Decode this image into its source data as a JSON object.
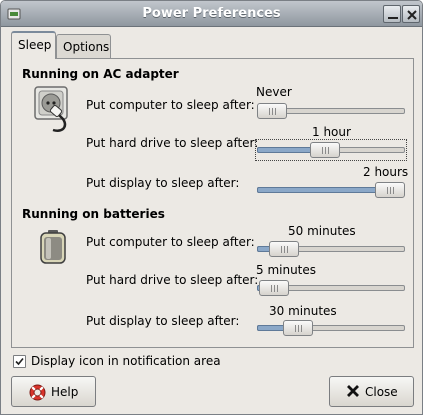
{
  "window": {
    "title": "Power Preferences"
  },
  "tabs": [
    {
      "label": "Sleep",
      "selected": true
    },
    {
      "label": "Options",
      "selected": false
    }
  ],
  "ac": {
    "heading": "Running on AC adapter",
    "rows": [
      {
        "label": "Put computer to sleep after:",
        "value": "Never",
        "fraction": 0.0
      },
      {
        "label": "Put hard drive to sleep after:",
        "value": "1 hour",
        "fraction": 0.45
      },
      {
        "label": "Put display to sleep after:",
        "value": "2 hours",
        "fraction": 1.0
      }
    ]
  },
  "battery": {
    "heading": "Running on batteries",
    "rows": [
      {
        "label": "Put computer to sleep after:",
        "value": "50 minutes",
        "fraction": 0.1
      },
      {
        "label": "Put hard drive to sleep after:",
        "value": "5 minutes",
        "fraction": 0.02
      },
      {
        "label": "Put display to sleep after:",
        "value": "30 minutes",
        "fraction": 0.22
      }
    ]
  },
  "notification": {
    "label": "Display icon in notification area",
    "checked": true
  },
  "buttons": {
    "help": "Help",
    "close": "Close"
  },
  "colors": {
    "titlebar": "#8f979f",
    "slider_fill": "#8ba8c8",
    "help_icon": "#d9342b"
  },
  "icons": [
    "power-plug-icon",
    "battery-icon",
    "help-lifebuoy-icon",
    "close-x-icon",
    "minimize-icon",
    "window-close-icon",
    "checkmark-icon"
  ]
}
